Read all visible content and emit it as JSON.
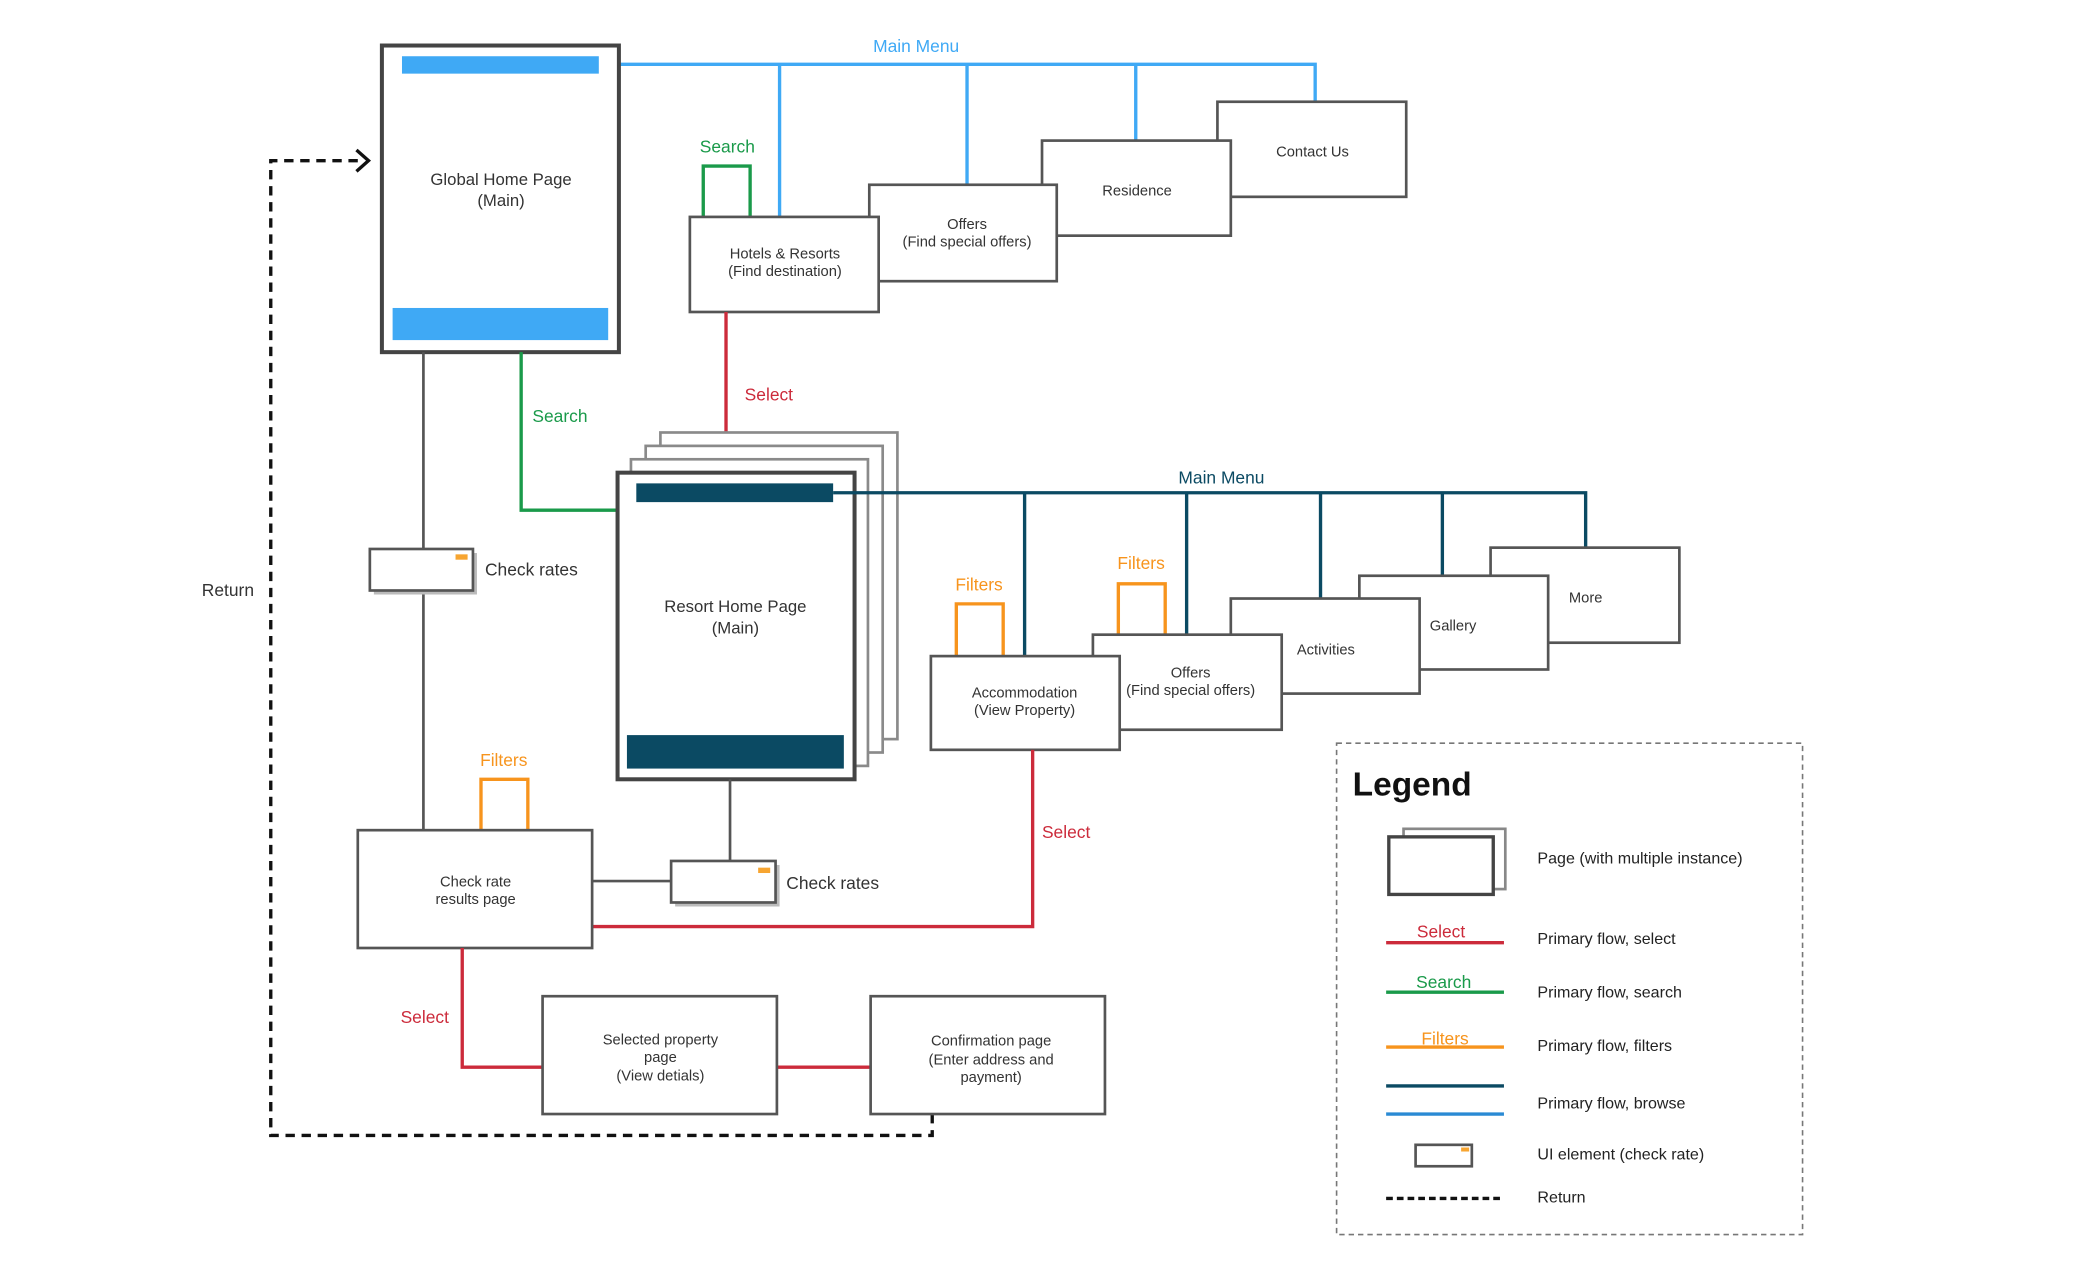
{
  "colors": {
    "browse_light": "#3fa9f5",
    "browse_dark": "#0b4a63",
    "search": "#1a9a4a",
    "select": "#cc2b3b",
    "filters": "#f7941d",
    "return": "#111111"
  },
  "labels": {
    "main_menu": "Main Menu",
    "search": "Search",
    "select": "Select",
    "filters": "Filters",
    "check_rates": "Check rates",
    "return": "Return"
  },
  "nodes": {
    "global_home": [
      "Global Home Page",
      "(Main)"
    ],
    "hotels": [
      "Hotels & Resorts",
      "(Find destination)"
    ],
    "offers_global": [
      "Offers",
      "(Find special offers)"
    ],
    "residence": [
      "Residence"
    ],
    "contact": [
      "Contact Us"
    ],
    "resort_home": [
      "Resort Home Page",
      "(Main)"
    ],
    "accommodation": [
      "Accommodation",
      "(View Property)"
    ],
    "offers_resort": [
      "Offers",
      "(Find special offers)"
    ],
    "activities": [
      "Activities"
    ],
    "gallery": [
      "Gallery"
    ],
    "more": [
      "More"
    ],
    "results": [
      "Check rate",
      "results page"
    ],
    "selected": [
      "Selected property",
      "page",
      "(View detials)"
    ],
    "confirmation": [
      "Confirmation page",
      "(Enter address and",
      "payment)"
    ]
  },
  "legend": {
    "title": "Legend",
    "items": [
      {
        "label": "Page (with multiple instance)",
        "icon": "stacked-page"
      },
      {
        "label": "Primary flow, select",
        "line_label": "Select"
      },
      {
        "label": "Primary flow, search",
        "line_label": "Search"
      },
      {
        "label": "Primary flow, filters",
        "line_label": "Filters"
      },
      {
        "label": "Primary flow, browse"
      },
      {
        "label": "UI element (check rate)",
        "icon": "check-rate-widget"
      },
      {
        "label": "Return",
        "icon": "dashed-line"
      }
    ]
  }
}
